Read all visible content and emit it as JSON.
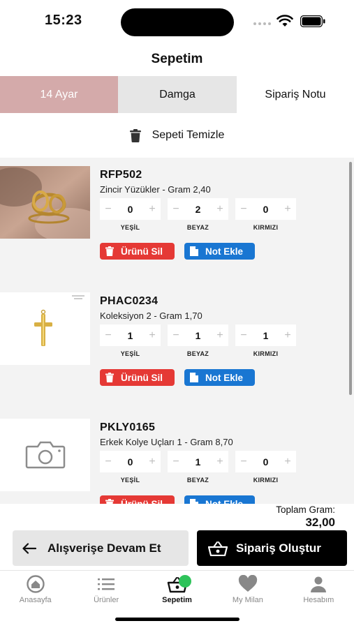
{
  "status_bar": {
    "time": "15:23"
  },
  "title": "Sepetim",
  "tabs": [
    {
      "label": "14 Ayar"
    },
    {
      "label": "Damga"
    },
    {
      "label": "Sipariş Notu"
    }
  ],
  "clear_cart": "Sepeti Temizle",
  "variant_labels": [
    "YEŞİL",
    "BEYAZ",
    "KIRMIZI"
  ],
  "items": [
    {
      "code": "RFP502",
      "description": "Zincir Yüzükler - Gram 2,40",
      "quantities": [
        "0",
        "2",
        "0"
      ],
      "image": "ring"
    },
    {
      "code": "PHAC0234",
      "description": "Koleksiyon 2 - Gram 1,70",
      "quantities": [
        "1",
        "1",
        "1"
      ],
      "image": "cross-pendant"
    },
    {
      "code": "PKLY0165",
      "description": "Erkek Kolye Uçları 1 - Gram 8,70",
      "quantities": [
        "0",
        "1",
        "0"
      ],
      "image": "camera-placeholder"
    }
  ],
  "buttons": {
    "delete": "Ürünü Sil",
    "add_note": "Not Ekle",
    "continue": "Alışverişe Devam Et",
    "order": "Sipariş Oluştur"
  },
  "total": {
    "label": "Toplam Gram:",
    "value": "32,00"
  },
  "nav": [
    {
      "label": "Anasayfa",
      "icon": "home-icon"
    },
    {
      "label": "Ürünler",
      "icon": "list-icon"
    },
    {
      "label": "Sepetim",
      "icon": "basket-icon",
      "active": true
    },
    {
      "label": "My Milan",
      "icon": "heart-icon"
    },
    {
      "label": "Hesabım",
      "icon": "user-icon"
    }
  ],
  "colors": {
    "tab_active": "#d4aaaa",
    "delete": "#e53935",
    "note": "#1976d2",
    "badge": "#2ec35a"
  }
}
